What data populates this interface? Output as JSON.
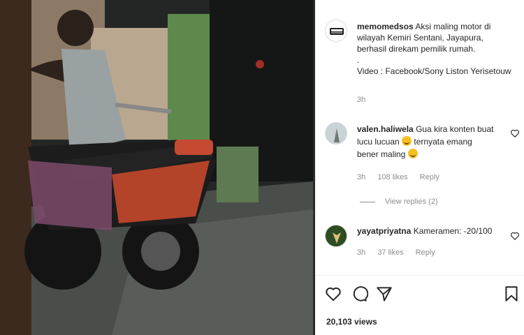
{
  "post": {
    "author": "memomedsos",
    "caption_lines": [
      "Aksi maling motor di",
      "wilayah Kemiri Sentani, Jayapura,",
      "berhasil direkam pemilik rumah.",
      ".",
      "Video : Facebook/Sony Liston Yerisetouw"
    ],
    "time": "3h"
  },
  "comments": [
    {
      "username": "valen.haliwela",
      "text_1": "Gua kira konten buat",
      "text_2a": "lucu lucuan",
      "text_2b": "ternyata emang",
      "text_3a": "bener maling",
      "time": "3h",
      "likes": "108 likes",
      "reply": "Reply",
      "view_replies": "View replies (2)"
    },
    {
      "username": "yayatpriyatna",
      "text": "Kameramen: -20/100",
      "time": "3h",
      "likes": "37 likes",
      "reply": "Reply"
    }
  ],
  "footer": {
    "views": "20,103 views"
  },
  "icons": {
    "like": "heart-icon",
    "comment": "comment-icon",
    "share": "paper-plane-icon",
    "save": "bookmark-icon"
  },
  "colors": {
    "text": "#262626",
    "secondary": "#8e8e8e",
    "media_bg": "#1a1d1c"
  }
}
